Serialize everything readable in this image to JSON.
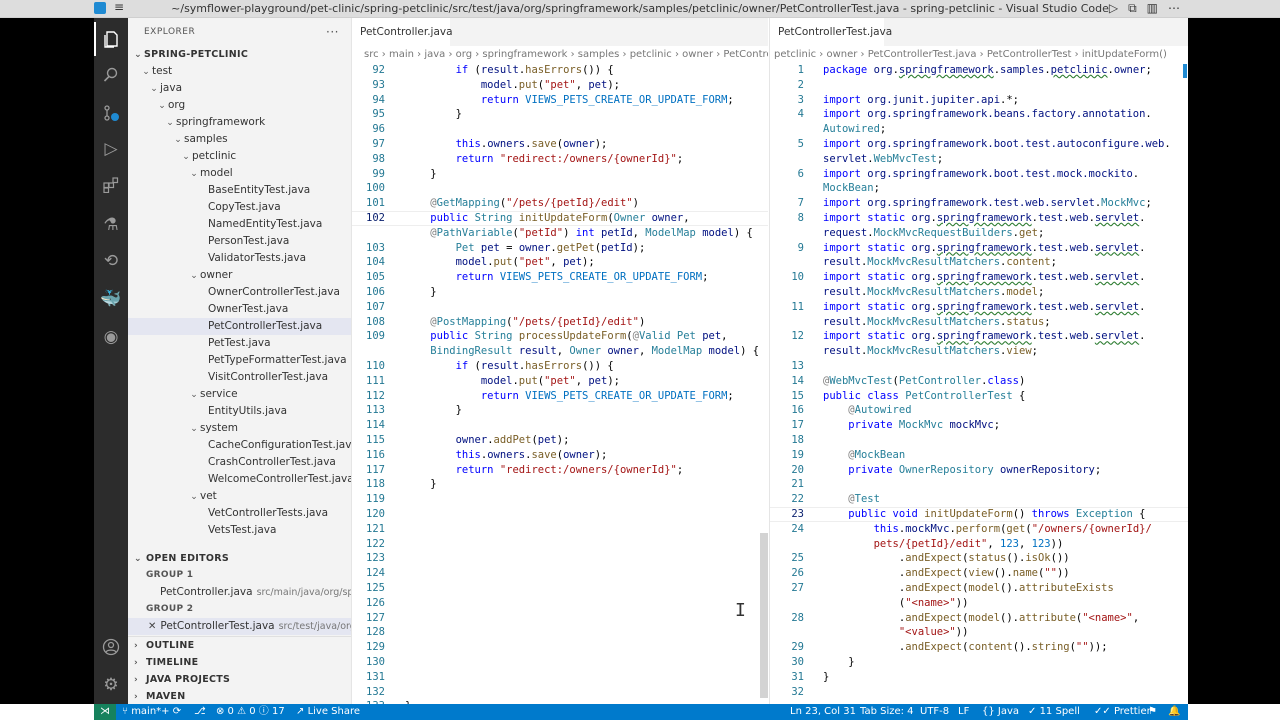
{
  "window": {
    "title": "~/symflower-playground/pet-clinic/spring-petclinic/src/test/java/org/springframework/samples/petclinic/owner/PetControllerTest.java - spring-petclinic - Visual Studio Code"
  },
  "sidebar": {
    "header": "EXPLORER",
    "more": "···",
    "project": "SPRING-PETCLINIC",
    "tree": [
      {
        "label": "test",
        "chev": "⌄",
        "indent": 1
      },
      {
        "label": "java",
        "chev": "⌄",
        "indent": 2
      },
      {
        "label": "org",
        "chev": "⌄",
        "indent": 3
      },
      {
        "label": "springframework",
        "chev": "⌄",
        "indent": 4
      },
      {
        "label": "samples",
        "chev": "⌄",
        "indent": 5
      },
      {
        "label": "petclinic",
        "chev": "⌄",
        "indent": 6
      },
      {
        "label": "model",
        "chev": "⌄",
        "indent": 7
      },
      {
        "label": "BaseEntityTest.java",
        "chev": "",
        "indent": 8
      },
      {
        "label": "CopyTest.java",
        "chev": "",
        "indent": 8
      },
      {
        "label": "NamedEntityTest.java",
        "chev": "",
        "indent": 8
      },
      {
        "label": "PersonTest.java",
        "chev": "",
        "indent": 8
      },
      {
        "label": "ValidatorTests.java",
        "chev": "",
        "indent": 8
      },
      {
        "label": "owner",
        "chev": "⌄",
        "indent": 7
      },
      {
        "label": "OwnerControllerTest.java",
        "chev": "",
        "indent": 8
      },
      {
        "label": "OwnerTest.java",
        "chev": "",
        "indent": 8
      },
      {
        "label": "PetControllerTest.java",
        "chev": "",
        "indent": 8,
        "selected": true
      },
      {
        "label": "PetTest.java",
        "chev": "",
        "indent": 8
      },
      {
        "label": "PetTypeFormatterTest.java",
        "chev": "",
        "indent": 8
      },
      {
        "label": "VisitControllerTest.java",
        "chev": "",
        "indent": 8
      },
      {
        "label": "service",
        "chev": "⌄",
        "indent": 7
      },
      {
        "label": "EntityUtils.java",
        "chev": "",
        "indent": 8
      },
      {
        "label": "system",
        "chev": "⌄",
        "indent": 7
      },
      {
        "label": "CacheConfigurationTest.java",
        "chev": "",
        "indent": 8
      },
      {
        "label": "CrashControllerTest.java",
        "chev": "",
        "indent": 8
      },
      {
        "label": "WelcomeControllerTest.java",
        "chev": "",
        "indent": 8
      },
      {
        "label": "vet",
        "chev": "⌄",
        "indent": 7
      },
      {
        "label": "VetControllerTests.java",
        "chev": "",
        "indent": 8
      },
      {
        "label": "VetsTest.java",
        "chev": "",
        "indent": 8
      }
    ],
    "open_editors": {
      "label": "OPEN EDITORS",
      "group1": "GROUP 1",
      "group1_file": "PetController.java",
      "group1_desc": "src/main/java/org/spr...",
      "group2": "GROUP 2",
      "group2_file": "PetControllerTest.java",
      "group2_desc": "src/test/java/org...",
      "close": "✕"
    },
    "sections": [
      "OUTLINE",
      "TIMELINE",
      "JAVA PROJECTS",
      "MAVEN"
    ]
  },
  "editor_left": {
    "tab": "PetController.java",
    "breadcrumb": [
      "src",
      "main",
      "java",
      "org",
      "springframework",
      "samples",
      "petclinic",
      "owner",
      "PetContro"
    ],
    "lines": [
      {
        "n": "92",
        "html": "        <span class='kw'>if</span> (<span class='vr'>result</span>.<span class='fn'>hasErrors</span>()) {"
      },
      {
        "n": "93",
        "html": "            <span class='vr'>model</span>.<span class='fn'>put</span>(<span class='str'>\"pet\"</span>, <span class='vr'>pet</span>);"
      },
      {
        "n": "94",
        "html": "            <span class='kw'>return</span> <span class='cst'>VIEWS_PETS_CREATE_OR_UPDATE_FORM</span>;"
      },
      {
        "n": "95",
        "html": "        }"
      },
      {
        "n": "96",
        "html": ""
      },
      {
        "n": "97",
        "html": "        <span class='kw'>this</span>.<span class='vr'>owners</span>.<span class='fn'>save</span>(<span class='vr'>owner</span>);"
      },
      {
        "n": "98",
        "html": "        <span class='kw'>return</span> <span class='str'>\"redirect:/owners/{ownerId}\"</span>;"
      },
      {
        "n": "99",
        "html": "    }"
      },
      {
        "n": "100",
        "html": ""
      },
      {
        "n": "101",
        "html": "    <span class='ann'>@</span><span class='ty'>GetMapping</span>(<span class='str'>\"/pets/{petId}/edit\"</span>)"
      },
      {
        "n": "102",
        "html": "    <span class='kw'>public</span> <span class='ty'>String</span> <span class='fn'>initUpdateForm</span>(<span class='ty'>Owner</span> <span class='vr'>owner</span>,",
        "cur": true
      },
      {
        "n": "",
        "html": "    <span class='ann'>@</span><span class='ty'>PathVariable</span>(<span class='str'>\"petId\"</span>) <span class='kw'>int</span> <span class='vr'>petId</span>, <span class='ty'>ModelMap</span> <span class='vr'>model</span>) {"
      },
      {
        "n": "103",
        "html": "        <span class='ty'>Pet</span> <span class='vr'>pet</span> = <span class='vr'>owner</span>.<span class='fn'>getPet</span>(<span class='vr'>petId</span>);"
      },
      {
        "n": "104",
        "html": "        <span class='vr'>model</span>.<span class='fn'>put</span>(<span class='str'>\"pet\"</span>, <span class='vr'>pet</span>);"
      },
      {
        "n": "105",
        "html": "        <span class='kw'>return</span> <span class='cst'>VIEWS_PETS_CREATE_OR_UPDATE_FORM</span>;"
      },
      {
        "n": "106",
        "html": "    }"
      },
      {
        "n": "107",
        "html": ""
      },
      {
        "n": "108",
        "html": "    <span class='ann'>@</span><span class='ty'>PostMapping</span>(<span class='str'>\"/pets/{petId}/edit\"</span>)"
      },
      {
        "n": "109",
        "html": "    <span class='kw'>public</span> <span class='ty'>String</span> <span class='fn'>processUpdateForm</span>(<span class='ann'>@</span><span class='ty'>Valid</span> <span class='ty'>Pet</span> <span class='vr'>pet</span>,"
      },
      {
        "n": "",
        "html": "    <span class='ty'>BindingResult</span> <span class='vr'>result</span>, <span class='ty'>Owner</span> <span class='vr'>owner</span>, <span class='ty'>ModelMap</span> <span class='vr'>model</span>) {"
      },
      {
        "n": "110",
        "html": "        <span class='kw'>if</span> (<span class='vr'>result</span>.<span class='fn'>hasErrors</span>()) {"
      },
      {
        "n": "111",
        "html": "            <span class='vr'>model</span>.<span class='fn'>put</span>(<span class='str'>\"pet\"</span>, <span class='vr'>pet</span>);"
      },
      {
        "n": "112",
        "html": "            <span class='kw'>return</span> <span class='cst'>VIEWS_PETS_CREATE_OR_UPDATE_FORM</span>;"
      },
      {
        "n": "113",
        "html": "        }"
      },
      {
        "n": "114",
        "html": ""
      },
      {
        "n": "115",
        "html": "        <span class='vr'>owner</span>.<span class='fn'>addPet</span>(<span class='vr'>pet</span>);"
      },
      {
        "n": "116",
        "html": "        <span class='kw'>this</span>.<span class='vr'>owners</span>.<span class='fn'>save</span>(<span class='vr'>owner</span>);"
      },
      {
        "n": "117",
        "html": "        <span class='kw'>return</span> <span class='str'>\"redirect:/owners/{ownerId}\"</span>;"
      },
      {
        "n": "118",
        "html": "    }"
      },
      {
        "n": "119",
        "html": ""
      },
      {
        "n": "120",
        "html": ""
      },
      {
        "n": "121",
        "html": ""
      },
      {
        "n": "122",
        "html": ""
      },
      {
        "n": "123",
        "html": ""
      },
      {
        "n": "124",
        "html": ""
      },
      {
        "n": "125",
        "html": ""
      },
      {
        "n": "126",
        "html": ""
      },
      {
        "n": "127",
        "html": ""
      },
      {
        "n": "128",
        "html": ""
      },
      {
        "n": "129",
        "html": ""
      },
      {
        "n": "130",
        "html": ""
      },
      {
        "n": "131",
        "html": ""
      },
      {
        "n": "132",
        "html": ""
      },
      {
        "n": "133",
        "html": "}"
      }
    ]
  },
  "editor_right": {
    "tab": "PetControllerTest.java",
    "breadcrumb": [
      "petclinic",
      "owner",
      "PetControllerTest.java",
      "PetControllerTest",
      "initUpdateForm()"
    ],
    "lines": [
      {
        "n": "1",
        "html": "<span class='kw'>package</span> <span class='pk'>org</span>.<span class='pk sq'>springframework</span>.<span class='pk'>samples</span>.<span class='pk sq'>petclinic</span>.<span class='pk'>owner</span>;"
      },
      {
        "n": "2",
        "html": ""
      },
      {
        "n": "3",
        "html": "<span class='kw'>import</span> <span class='pk'>org.junit.jupiter.api</span>.*;"
      },
      {
        "n": "4",
        "html": "<span class='kw'>import</span> <span class='pk'>org.springframework.beans.factory.annotation</span>."
      },
      {
        "n": "",
        "html": "<span class='ty'>Autowired</span>;"
      },
      {
        "n": "5",
        "html": "<span class='kw'>import</span> <span class='pk'>org.springframework.boot.test.autoconfigure.web</span>."
      },
      {
        "n": "",
        "html": "<span class='pk'>servlet</span>.<span class='ty'>WebMvcTest</span>;"
      },
      {
        "n": "6",
        "html": "<span class='kw'>import</span> <span class='pk'>org.springframework.boot.test.mock.mockito</span>."
      },
      {
        "n": "",
        "html": "<span class='ty'>MockBean</span>;"
      },
      {
        "n": "7",
        "html": "<span class='kw'>import</span> <span class='pk'>org.springframework.test.web.servlet</span>.<span class='ty'>MockMvc</span>;"
      },
      {
        "n": "8",
        "html": "<span class='kw'>import static</span> <span class='pk'>org</span>.<span class='pk sq'>springframework</span>.<span class='pk'>test</span>.<span class='pk'>web</span>.<span class='pk sq'>servlet</span>."
      },
      {
        "n": "",
        "html": "<span class='pk'>request</span>.<span class='ty'>MockMvcRequestBuilders</span>.<span class='fn'>get</span>;"
      },
      {
        "n": "9",
        "html": "<span class='kw'>import static</span> <span class='pk'>org</span>.<span class='pk sq'>springframework</span>.<span class='pk'>test</span>.<span class='pk'>web</span>.<span class='pk sq'>servlet</span>."
      },
      {
        "n": "",
        "html": "<span class='pk'>result</span>.<span class='ty'>MockMvcResultMatchers</span>.<span class='fn'>content</span>;"
      },
      {
        "n": "10",
        "html": "<span class='kw'>import static</span> <span class='pk'>org</span>.<span class='pk sq'>springframework</span>.<span class='pk'>test</span>.<span class='pk'>web</span>.<span class='pk sq'>servlet</span>."
      },
      {
        "n": "",
        "html": "<span class='pk'>result</span>.<span class='ty'>MockMvcResultMatchers</span>.<span class='fn'>model</span>;"
      },
      {
        "n": "11",
        "html": "<span class='kw'>import static</span> <span class='pk'>org</span>.<span class='pk sq'>springframework</span>.<span class='pk'>test</span>.<span class='pk'>web</span>.<span class='pk sq'>servlet</span>."
      },
      {
        "n": "",
        "html": "<span class='pk'>result</span>.<span class='ty'>MockMvcResultMatchers</span>.<span class='fn'>status</span>;"
      },
      {
        "n": "12",
        "html": "<span class='kw'>import static</span> <span class='pk'>org</span>.<span class='pk sq'>springframework</span>.<span class='pk'>test</span>.<span class='pk'>web</span>.<span class='pk sq'>servlet</span>."
      },
      {
        "n": "",
        "html": "<span class='pk'>result</span>.<span class='ty'>MockMvcResultMatchers</span>.<span class='fn'>view</span>;"
      },
      {
        "n": "13",
        "html": ""
      },
      {
        "n": "14",
        "html": "<span class='ann'>@</span><span class='ty'>WebMvcTest</span>(<span class='ty'>PetController</span>.<span class='kw'>class</span>)"
      },
      {
        "n": "15",
        "html": "<span class='kw'>public class</span> <span class='ty'>PetControllerTest</span> {"
      },
      {
        "n": "16",
        "html": "    <span class='ann'>@</span><span class='ty'>Autowired</span>"
      },
      {
        "n": "17",
        "html": "    <span class='kw'>private</span> <span class='ty'>MockMvc</span> <span class='vr'>mockMvc</span>;"
      },
      {
        "n": "18",
        "html": ""
      },
      {
        "n": "19",
        "html": "    <span class='ann'>@</span><span class='ty'>MockBean</span>"
      },
      {
        "n": "20",
        "html": "    <span class='kw'>private</span> <span class='ty'>OwnerRepository</span> <span class='vr'>ownerRepository</span>;"
      },
      {
        "n": "21",
        "html": ""
      },
      {
        "n": "22",
        "html": "    <span class='ann'>@</span><span class='ty'>Test</span>"
      },
      {
        "n": "23",
        "html": "    <span class='kw'>public void</span> <span class='fn'>initUpdateForm</span>() <span class='kw'>throws</span> <span class='ty'>Exception</span> {",
        "cur": true
      },
      {
        "n": "24",
        "html": "        <span class='kw'>this</span>.<span class='vr'>mockMvc</span>.<span class='fn'>perform</span>(<span class='fn'>get</span>(<span class='str'>\"/owners/{ownerId}/</span>"
      },
      {
        "n": "",
        "html": "        <span class='str'>pets/{petId}/edit\"</span>, <span class='cst'>123</span>, <span class='cst'>123</span>))"
      },
      {
        "n": "25",
        "html": "            .<span class='fn'>andExpect</span>(<span class='fn'>status</span>().<span class='fn'>isOk</span>())"
      },
      {
        "n": "26",
        "html": "            .<span class='fn'>andExpect</span>(<span class='fn'>view</span>().<span class='fn'>name</span>(<span class='str'>\"\"</span>))"
      },
      {
        "n": "27",
        "html": "            .<span class='fn'>andExpect</span>(<span class='fn'>model</span>().<span class='fn'>attributeExists</span>"
      },
      {
        "n": "",
        "html": "            (<span class='str'>\"&lt;name&gt;\"</span>))"
      },
      {
        "n": "28",
        "html": "            .<span class='fn'>andExpect</span>(<span class='fn'>model</span>().<span class='fn'>attribute</span>(<span class='str'>\"&lt;name&gt;\"</span>,"
      },
      {
        "n": "",
        "html": "            <span class='str'>\"&lt;value&gt;\"</span>))"
      },
      {
        "n": "29",
        "html": "            .<span class='fn'>andExpect</span>(<span class='fn'>content</span>().<span class='fn'>string</span>(<span class='str'>\"\"</span>));"
      },
      {
        "n": "30",
        "html": "    }"
      },
      {
        "n": "31",
        "html": "}"
      },
      {
        "n": "32",
        "html": ""
      }
    ]
  },
  "statusbar": {
    "remote": "⋊",
    "branch": "main*+",
    "sync": "⟳",
    "errors": "⊗ 0 ⚠ 0 ⓘ 17",
    "live_share": "Live Share",
    "position": "Ln 23, Col 31",
    "tab_size": "Tab Size: 4",
    "encoding": "UTF-8",
    "eol": "LF",
    "language": "Java",
    "spell": "11 Spell",
    "prettier": "Prettier"
  },
  "colors": {
    "statusbar": "#007acc",
    "activitybar": "#2c2c2c",
    "sidebar": "#f3f3f3"
  }
}
